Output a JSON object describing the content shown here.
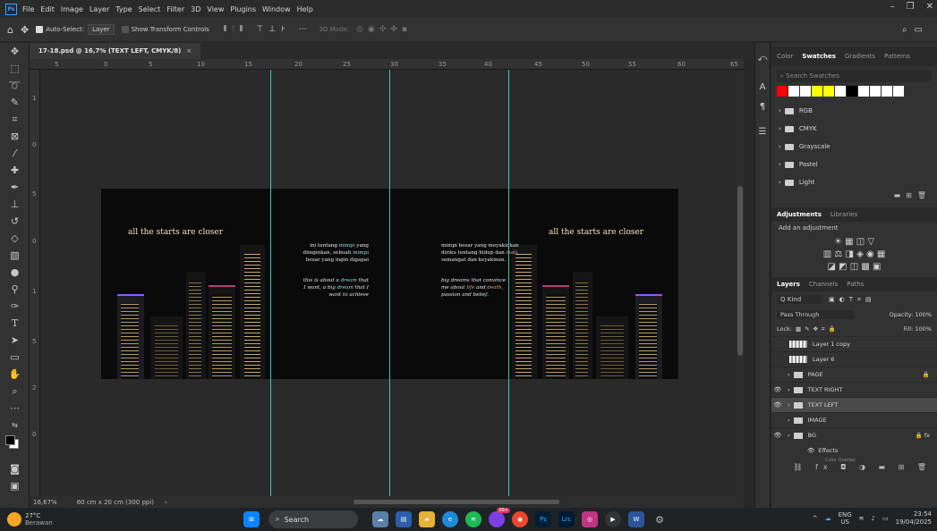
{
  "menu": {
    "items": [
      "File",
      "Edit",
      "Image",
      "Layer",
      "Type",
      "Select",
      "Filter",
      "3D",
      "View",
      "Plugins",
      "Window",
      "Help"
    ],
    "ps_logo": "Ps"
  },
  "options": {
    "auto_select": "Auto-Select:",
    "layer_dd": "Layer",
    "show_transform": "Show Transform Controls",
    "mode_3d": "3D Mode:"
  },
  "tab": {
    "title": "17-18.psd @ 16,7% (TEXT LEFT, CMYK/8)"
  },
  "ruler": {
    "h": [
      "5",
      "0",
      "5",
      "10",
      "15",
      "20",
      "25",
      "30",
      "35",
      "40",
      "45",
      "50",
      "55",
      "60",
      "65"
    ],
    "v": [
      "1",
      "0",
      "5",
      "0",
      "1",
      "5",
      "2",
      "0"
    ]
  },
  "status": {
    "zoom": "16,67%",
    "doc": "60 cm x 20 cm (300 ppi)"
  },
  "doc": {
    "title_left": "all the starts are closer",
    "title_right": "all the starts are closer",
    "p1a_1": "ini tentang ",
    "p1a_h1": "mimpi",
    "p1a_2": " yang",
    "p1b_1": "diinginkan, sebuah ",
    "p1b_h1": "mimpi",
    "p1c": "besar yang ingin digapai",
    "p2a_1": "this is about a ",
    "p2a_h": "dream",
    "p2a_2": " that",
    "p2b_1": "I want, a big ",
    "p2b_h": "dream",
    "p2b_2": " that I",
    "p2c": "want to achieve",
    "p3a_1": "mimpi besar yang meyakinkan",
    "p3b_1": "diriku tentang hidup dan ",
    "p3b_h": "mati,",
    "p3c": "semangat dan keyakinan.",
    "p4a": "big dreams that convince",
    "p4b_1": "me about ",
    "p4b_h1": "life",
    "p4b_2": " and ",
    "p4b_h2": "death,",
    "p4c": "passion and belief."
  },
  "panels": {
    "swatch_tabs": [
      "Color",
      "Swatches",
      "Gradients",
      "Patterns"
    ],
    "swatch_search": "Search Swatches",
    "swatch_colors": [
      "#ff0000",
      "#ffffff",
      "#ffffff",
      "#ffff00",
      "#ffff00",
      "#ffffff",
      "#000000",
      "#ffffff",
      "#ffffff",
      "#ffffff",
      "#ffffff"
    ],
    "folders": [
      "RGB",
      "CMYK",
      "Grayscale",
      "Pastel",
      "Light"
    ],
    "adj_tabs": [
      "Adjustments",
      "Libraries"
    ],
    "adj_label": "Add an adjustment",
    "layer_tabs": [
      "Layers",
      "Channels",
      "Paths"
    ],
    "kind": "Q Kind",
    "blend": "Pass Through",
    "opacity": "Opacity: 100%",
    "lock": "Lock:",
    "fill": "Fill: 100%",
    "layers": [
      {
        "name": "Layer 1 copy",
        "eye": ""
      },
      {
        "name": "Layer 6",
        "eye": ""
      },
      {
        "name": "PAGE",
        "eye": ""
      },
      {
        "name": "TEXT RIGHT",
        "eye": "👁"
      },
      {
        "name": "TEXT LEFT",
        "eye": "👁"
      },
      {
        "name": "IMAGE",
        "eye": ""
      },
      {
        "name": "BG",
        "eye": "👁"
      }
    ],
    "effects": "Effects",
    "color_overlay": "Color Overlay"
  },
  "taskbar": {
    "temp": "27°C",
    "weather": "Berawan",
    "search": "Search",
    "lang": "ENG",
    "region": "US",
    "time": "23:54",
    "date": "19/04/2025",
    "badge": "99+"
  }
}
